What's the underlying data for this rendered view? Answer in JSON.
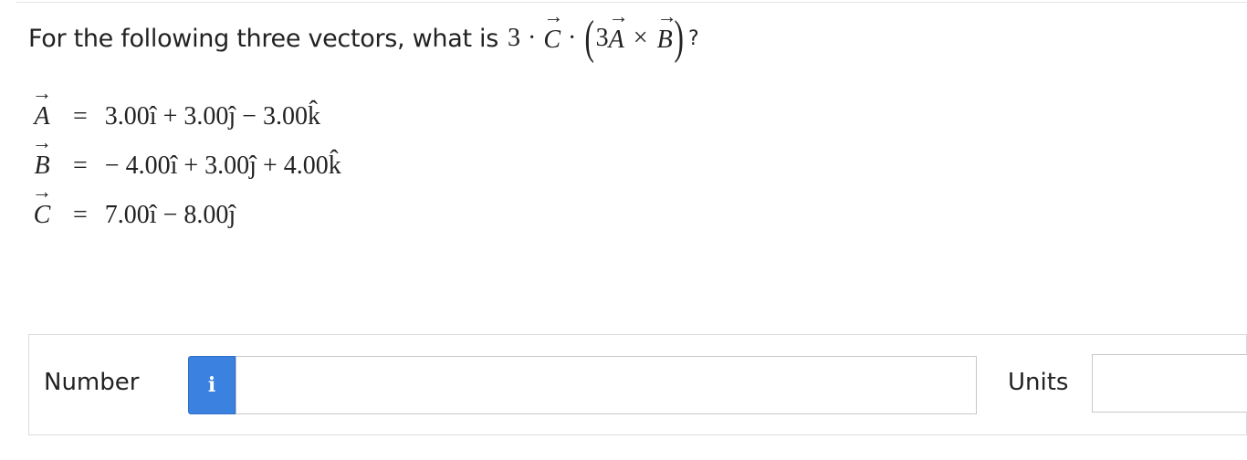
{
  "question": {
    "prompt": "For the following three vectors, what is",
    "coef": "3",
    "dot": "·",
    "vec_c": "C",
    "inner_coef": "3",
    "vec_a": "A",
    "cross": "×",
    "vec_b": "B",
    "open_paren": "(",
    "close_paren": ")",
    "qmark": "?",
    "arrow": "→"
  },
  "equations": {
    "a": {
      "name": "A",
      "equals": "=",
      "rhs": "3.00î + 3.00ĵ − 3.00k̂"
    },
    "b": {
      "name": "B",
      "equals": "=",
      "rhs": "− 4.00î + 3.00ĵ + 4.00k̂"
    },
    "c": {
      "name": "C",
      "equals": "=",
      "rhs": "7.00î − 8.00ĵ"
    }
  },
  "answer": {
    "number_label": "Number",
    "info_icon": "i",
    "number_value": "",
    "units_label": "Units",
    "units_value": ""
  }
}
